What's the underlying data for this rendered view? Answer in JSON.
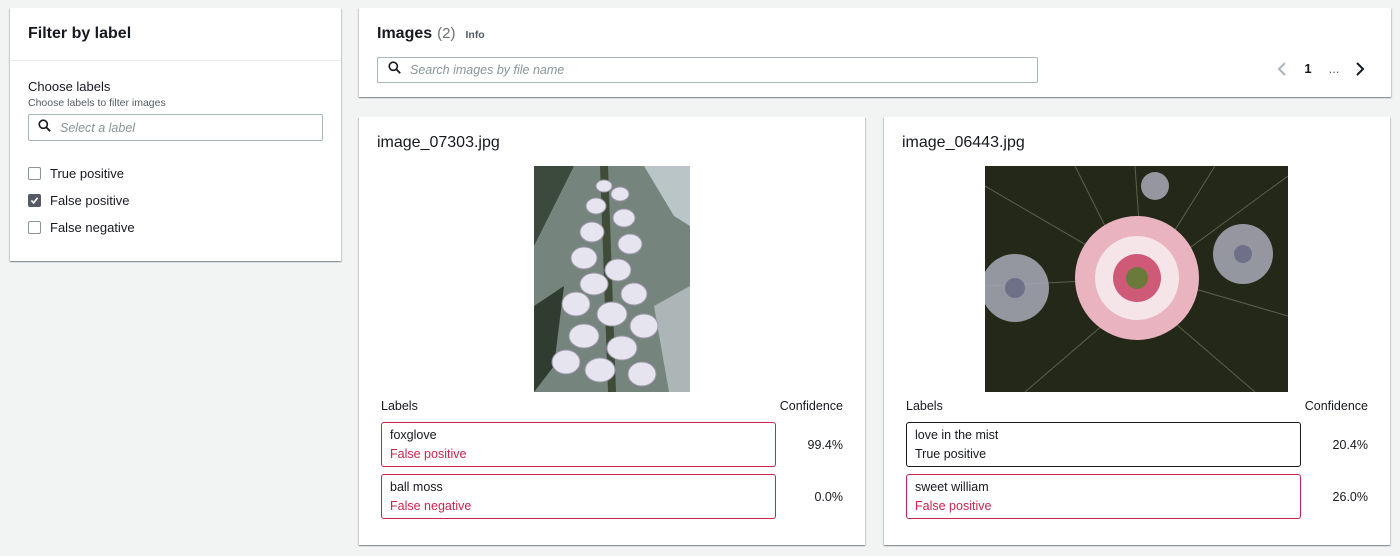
{
  "filter": {
    "title": "Filter by label",
    "choose_title": "Choose labels",
    "choose_desc": "Choose labels to filter images",
    "select_placeholder": "Select a label",
    "options": [
      {
        "label": "True positive",
        "checked": false
      },
      {
        "label": "False positive",
        "checked": true
      },
      {
        "label": "False negative",
        "checked": false
      }
    ]
  },
  "images": {
    "title": "Images",
    "count": "(2)",
    "info": "Info",
    "search_placeholder": "Search images by file name",
    "pagination": {
      "current_page": "1",
      "ellipsis": "..."
    }
  },
  "labels_header": "Labels",
  "confidence_header": "Confidence",
  "cards": [
    {
      "file_name": "image_07303.jpg",
      "image_description": "foxglove flowers",
      "labels": [
        {
          "name": "foxglove",
          "status": "False positive",
          "confidence": "99.4%",
          "tone": "red"
        },
        {
          "name": "ball moss",
          "status": "False negative",
          "confidence": "0.0%",
          "tone": "red"
        }
      ]
    },
    {
      "file_name": "image_06443.jpg",
      "image_description": "love in the mist flower",
      "labels": [
        {
          "name": "love in the mist",
          "status": "True positive",
          "confidence": "20.4%",
          "tone": "good"
        },
        {
          "name": "sweet william",
          "status": "False positive",
          "confidence": "26.0%",
          "tone": "red"
        }
      ]
    }
  ],
  "colors": {
    "background": "#f2f3f3",
    "error_red": "#c7254e",
    "border_grey": "#aab7b8"
  }
}
